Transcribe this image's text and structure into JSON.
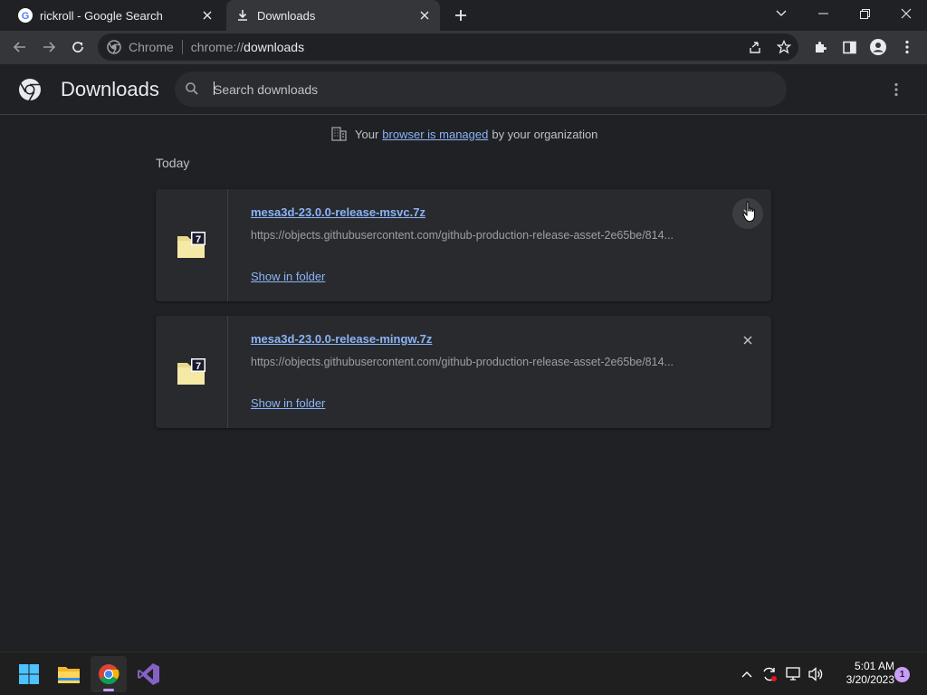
{
  "tabs": [
    {
      "title": "rickroll - Google Search",
      "active": false
    },
    {
      "title": "Downloads",
      "active": true
    }
  ],
  "address": {
    "site_label": "Chrome",
    "scheme": "chrome://",
    "host": "downloads"
  },
  "page": {
    "title": "Downloads",
    "search_placeholder": "Search downloads",
    "managed_prefix": "Your",
    "managed_link": "browser is managed",
    "managed_suffix": "by your organization",
    "section": "Today"
  },
  "downloads": [
    {
      "filename": "mesa3d-23.0.0-release-msvc.7z",
      "url": "https://objects.githubusercontent.com/github-production-release-asset-2e65be/814...",
      "action": "Show in folder"
    },
    {
      "filename": "mesa3d-23.0.0-release-mingw.7z",
      "url": "https://objects.githubusercontent.com/github-production-release-asset-2e65be/814...",
      "action": "Show in folder"
    }
  ],
  "taskbar": {
    "time": "5:01 AM",
    "date": "3/20/2023",
    "notifications": "1"
  },
  "colors": {
    "link": "#8ab4f8",
    "background": "#202124",
    "card": "#292a2d",
    "accent": "#c79df8"
  }
}
